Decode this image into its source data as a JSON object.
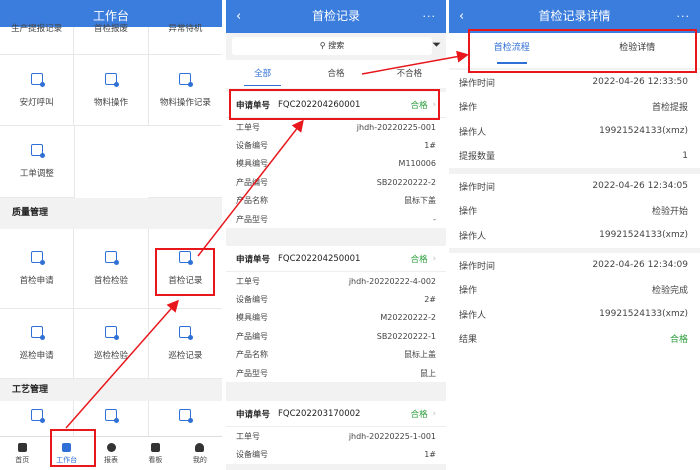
{
  "p1": {
    "title": "工作台",
    "top_row": [
      "生产提报记录",
      "首检报废",
      "异常待机"
    ],
    "row1": [
      "安灯呼叫",
      "物料操作",
      "物料操作记录"
    ],
    "row2": [
      "工单调整"
    ],
    "quality": "质量管理",
    "row3": [
      "首检申请",
      "首检检验",
      "首检记录"
    ],
    "row4": [
      "巡检申请",
      "巡检检验",
      "巡检记录"
    ],
    "process": "工艺管理",
    "tabbar": [
      "首页",
      "工作台",
      "报表",
      "看板",
      "我的"
    ]
  },
  "p2": {
    "title": "首检记录",
    "back": "‹",
    "more": "···",
    "search": "搜索",
    "tabs": [
      "全部",
      "合格",
      "不合格"
    ],
    "cards": [
      {
        "label": "申请单号",
        "number": "FQC202204260001",
        "status": "合格",
        "rows": [
          [
            "工单号",
            "jhdh-20220225-001"
          ],
          [
            "设备编号",
            "1#"
          ],
          [
            "模具编号",
            "M110006"
          ],
          [
            "产品编号",
            "SB20220222-2"
          ],
          [
            "产品名称",
            "鼠标下盖"
          ],
          [
            "产品型号",
            "-"
          ]
        ]
      },
      {
        "label": "申请单号",
        "number": "FQC202204250001",
        "status": "合格",
        "rows": [
          [
            "工单号",
            "jhdh-20220222-4-002"
          ],
          [
            "设备编号",
            "2#"
          ],
          [
            "模具编号",
            "M20220222-2"
          ],
          [
            "产品编号",
            "SB20220222-1"
          ],
          [
            "产品名称",
            "鼠标上盖"
          ],
          [
            "产品型号",
            "鼠上"
          ]
        ]
      },
      {
        "label": "申请单号",
        "number": "FQC202203170002",
        "status": "合格",
        "rows": [
          [
            "工单号",
            "jhdh-20220225-1-001"
          ],
          [
            "设备编号",
            "1#"
          ]
        ]
      }
    ]
  },
  "p3": {
    "title": "首检记录详情",
    "back": "‹",
    "more": "···",
    "tabs": [
      "首检流程",
      "检验详情"
    ],
    "groups": [
      [
        [
          "操作时间",
          "2022-04-26 12:33:50"
        ],
        [
          "操作",
          "首检提报"
        ],
        [
          "操作人",
          "19921524133(xmz)"
        ],
        [
          "提报数量",
          "1"
        ]
      ],
      [
        [
          "操作时间",
          "2022-04-26 12:34:05"
        ],
        [
          "操作",
          "检验开始"
        ],
        [
          "操作人",
          "19921524133(xmz)"
        ]
      ],
      [
        [
          "操作时间",
          "2022-04-26 12:34:09"
        ],
        [
          "操作",
          "检验完成"
        ],
        [
          "操作人",
          "19921524133(xmz)"
        ],
        [
          "结果",
          "合格"
        ]
      ]
    ]
  },
  "colors": {
    "header": "#3b7ddd",
    "accent": "#2f6fd6",
    "highlight": "#e8171c",
    "pass": "#2a9d3a"
  }
}
